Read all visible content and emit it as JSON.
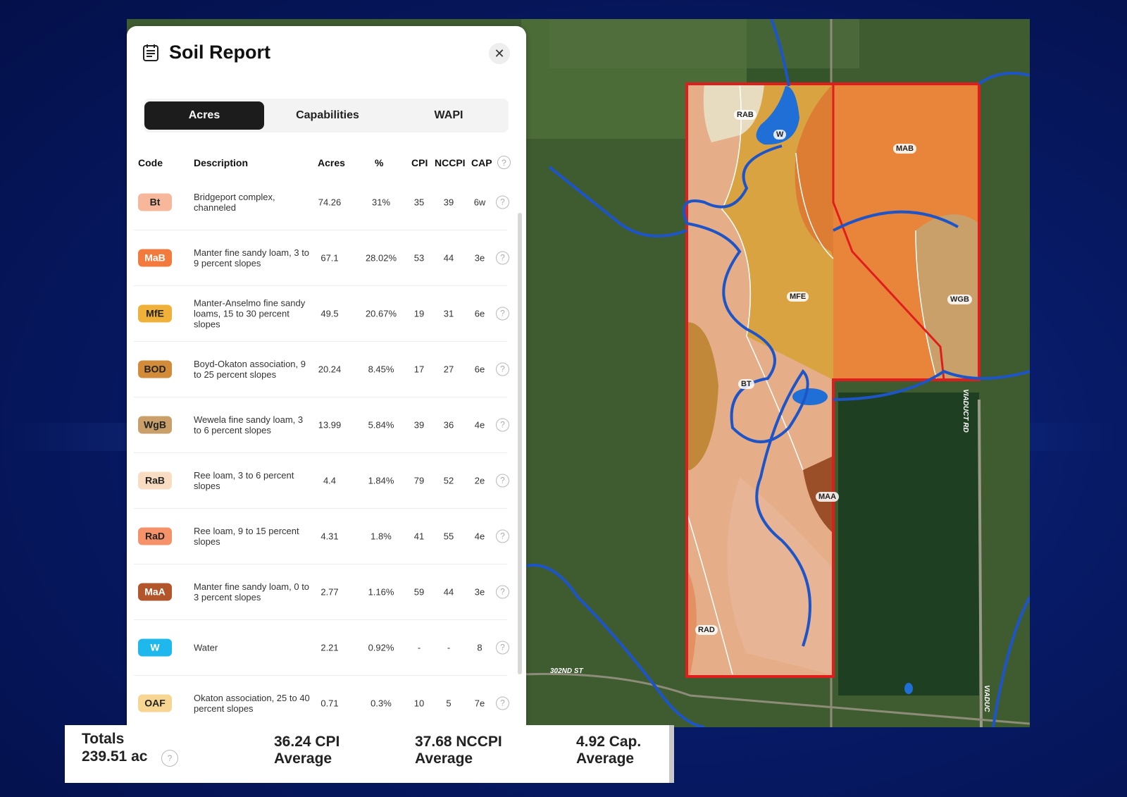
{
  "panel": {
    "title": "Soil Report",
    "tabs": [
      "Acres",
      "Capabilities",
      "WAPI"
    ],
    "active_tab": "Acres",
    "columns": [
      "Code",
      "Description",
      "Acres",
      "%",
      "CPI",
      "NCCPI",
      "CAP"
    ],
    "rows": [
      {
        "code": "Bt",
        "color": "#f6b79b",
        "text_color": "#222",
        "description": "Bridgeport complex, channeled",
        "acres": "74.26",
        "pct": "31%",
        "cpi": "35",
        "nccpi": "39",
        "cap": "6w"
      },
      {
        "code": "MaB",
        "color": "#f27a3c",
        "text_color": "#fff",
        "description": "Manter fine sandy loam, 3 to 9 percent slopes",
        "acres": "67.1",
        "pct": "28.02%",
        "cpi": "53",
        "nccpi": "44",
        "cap": "3e"
      },
      {
        "code": "MfE",
        "color": "#efb13a",
        "text_color": "#222",
        "description": "Manter-Anselmo fine sandy loams, 15 to 30 percent slopes",
        "acres": "49.5",
        "pct": "20.67%",
        "cpi": "19",
        "nccpi": "31",
        "cap": "6e"
      },
      {
        "code": "BOD",
        "color": "#d18b39",
        "text_color": "#222",
        "description": "Boyd-Okaton association, 9 to 25 percent slopes",
        "acres": "20.24",
        "pct": "8.45%",
        "cpi": "17",
        "nccpi": "27",
        "cap": "6e"
      },
      {
        "code": "WgB",
        "color": "#c9a06a",
        "text_color": "#222",
        "description": "Wewela fine sandy loam, 3 to 6 percent slopes",
        "acres": "13.99",
        "pct": "5.84%",
        "cpi": "39",
        "nccpi": "36",
        "cap": "4e"
      },
      {
        "code": "RaB",
        "color": "#f9ddc2",
        "text_color": "#222",
        "description": "Ree loam, 3 to 6 percent slopes",
        "acres": "4.4",
        "pct": "1.84%",
        "cpi": "79",
        "nccpi": "52",
        "cap": "2e"
      },
      {
        "code": "RaD",
        "color": "#f5926a",
        "text_color": "#222",
        "description": "Ree loam, 9 to 15 percent slopes",
        "acres": "4.31",
        "pct": "1.8%",
        "cpi": "41",
        "nccpi": "55",
        "cap": "4e"
      },
      {
        "code": "MaA",
        "color": "#b2552b",
        "text_color": "#fff",
        "description": "Manter fine sandy loam, 0 to 3 percent slopes",
        "acres": "2.77",
        "pct": "1.16%",
        "cpi": "59",
        "nccpi": "44",
        "cap": "3e"
      },
      {
        "code": "W",
        "color": "#1fb8ec",
        "text_color": "#fff",
        "description": "Water",
        "acres": "2.21",
        "pct": "0.92%",
        "cpi": "-",
        "nccpi": "-",
        "cap": "8"
      },
      {
        "code": "OAF",
        "color": "#f7d693",
        "text_color": "#222",
        "description": "Okaton association, 25 to 40 percent slopes",
        "acres": "0.71",
        "pct": "0.3%",
        "cpi": "10",
        "nccpi": "5",
        "cap": "7e"
      }
    ]
  },
  "totals": {
    "label": "Totals",
    "acres": "239.51 ac",
    "cpi_value": "36.24 CPI",
    "cpi_sub": "Average",
    "nccpi_value": "37.68 NCCPI",
    "nccpi_sub": "Average",
    "cap_value": "4.92 Cap.",
    "cap_sub": "Average"
  },
  "map": {
    "labels": [
      "RAB",
      "W",
      "MAB",
      "MFE",
      "WGB",
      "BT",
      "MAA",
      "RAD"
    ],
    "roads": [
      "302ND ST",
      "VIADUCT RD",
      "VIADUC"
    ]
  }
}
